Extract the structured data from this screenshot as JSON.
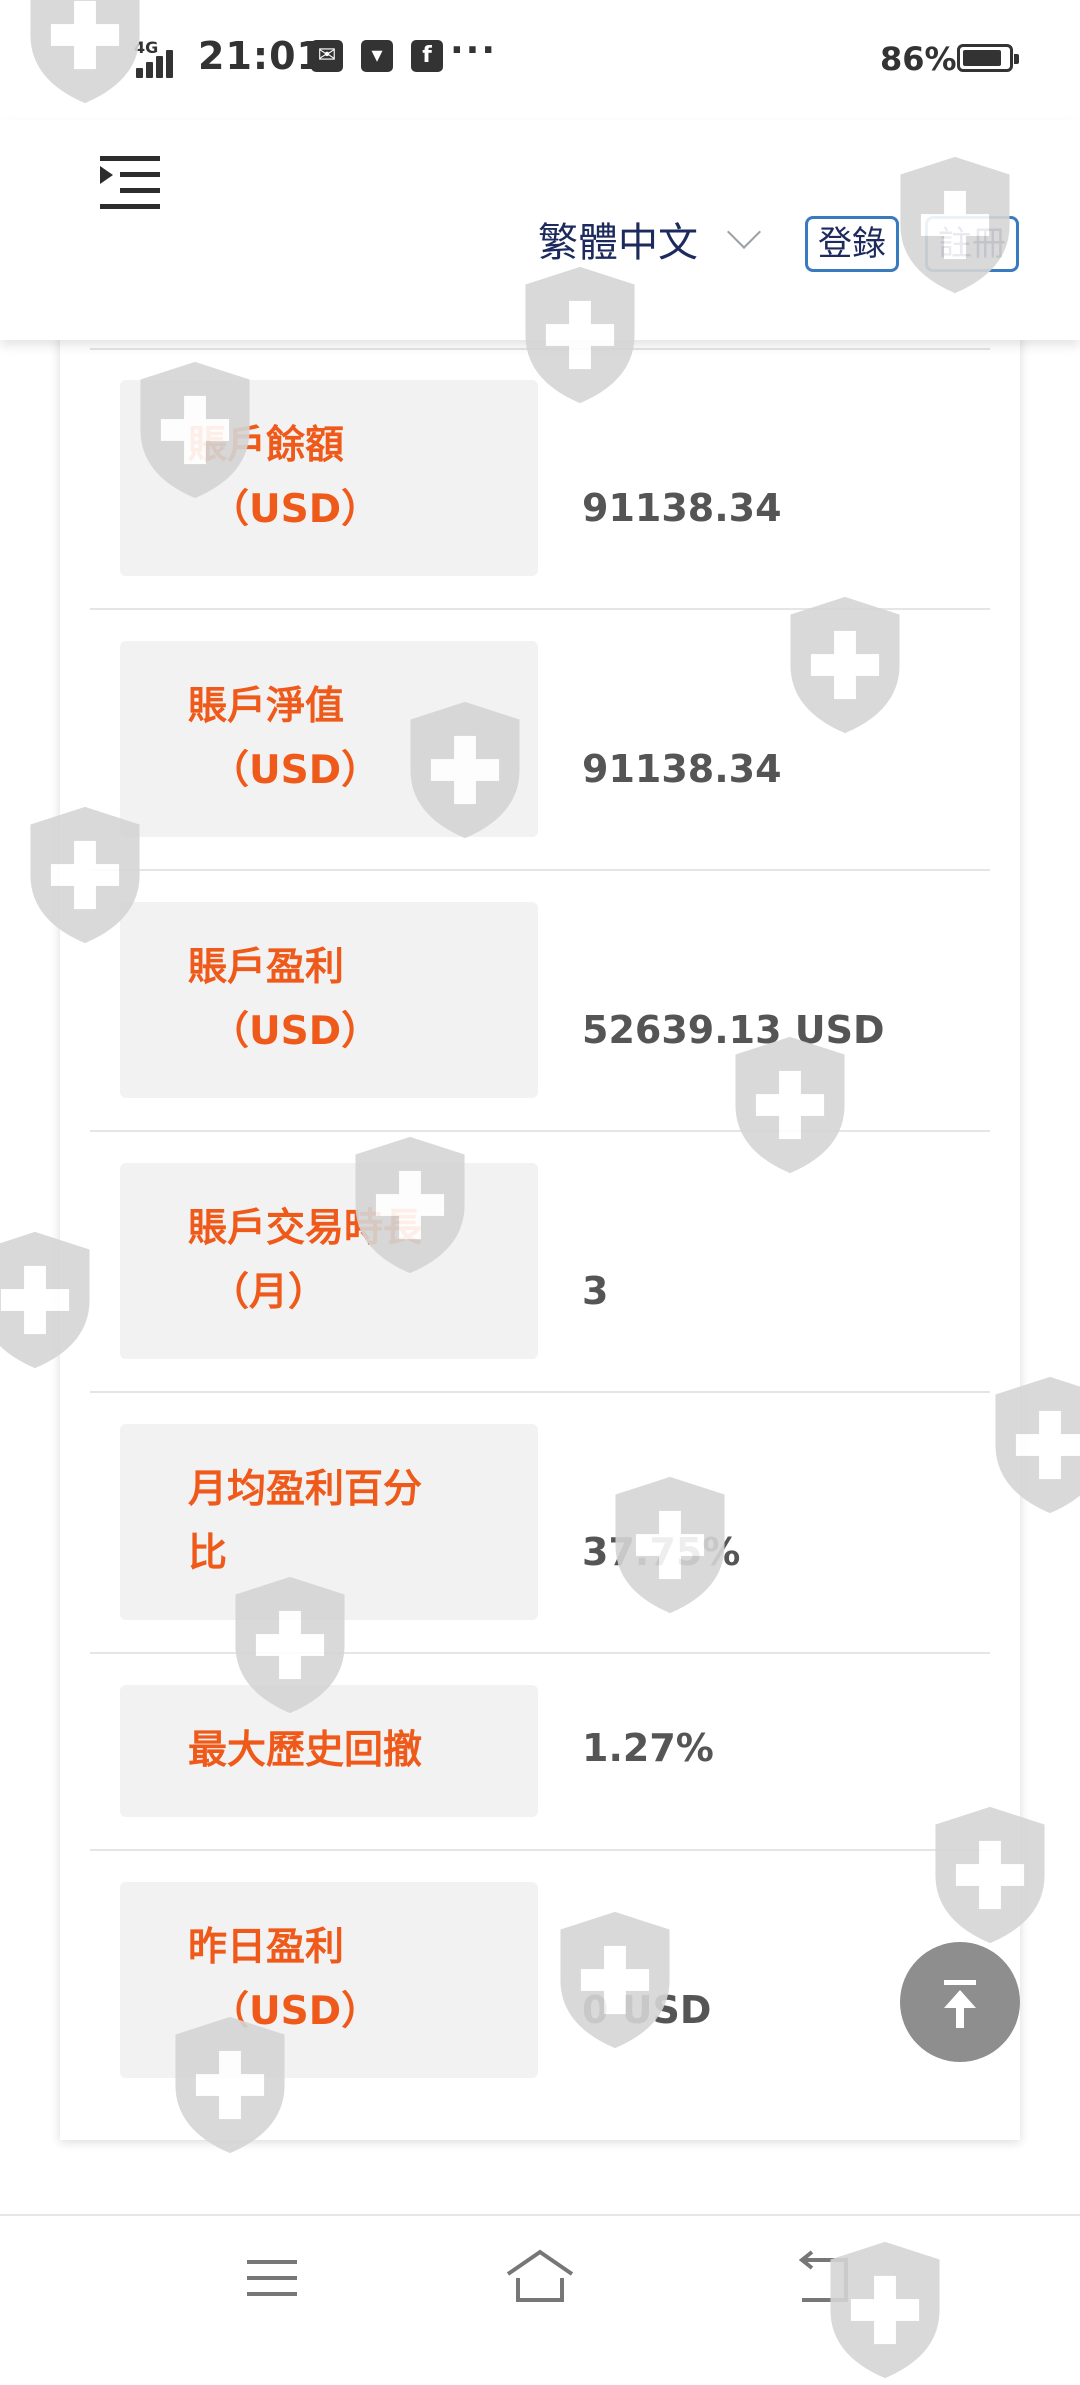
{
  "status_bar": {
    "network": "4G",
    "time": "21:01",
    "more": "···",
    "battery": "86%",
    "battery_level": 0.86,
    "notification_icons": [
      "mail-icon",
      "bag-icon",
      "facebook-icon"
    ]
  },
  "header": {
    "language": "繁體中文",
    "login_label": "登錄",
    "register_label": "註冊"
  },
  "stats": [
    {
      "label": "賬戶餘額",
      "unit": "（USD）",
      "value": "91138.34"
    },
    {
      "label": "賬戶淨值",
      "unit": "（USD）",
      "value": "91138.34"
    },
    {
      "label": "賬戶盈利",
      "unit": "（USD）",
      "value": "52639.13 USD"
    },
    {
      "label": "賬戶交易時長",
      "unit": "（月）",
      "value": "3"
    },
    {
      "label": "月均盈利百分",
      "unit": "比",
      "value": "37.75%"
    },
    {
      "label": "最大歷史回撤",
      "unit": "",
      "value": "1.27%"
    },
    {
      "label": "昨日盈利",
      "unit": "（USD）",
      "value": "0 USD"
    }
  ],
  "colors": {
    "label_text": "#ef5a1a",
    "label_bg": "#f2f2f2",
    "value_text": "#555555",
    "nav_text": "#1d2a5e",
    "button_border": "#3a7bbf",
    "scroll_top_bg": "#8e8e8e"
  },
  "icons": {
    "menu": "menu-indent-icon",
    "scroll_top": "arrow-to-top-icon",
    "nav": [
      "recent-apps-icon",
      "home-icon",
      "back-icon"
    ]
  }
}
